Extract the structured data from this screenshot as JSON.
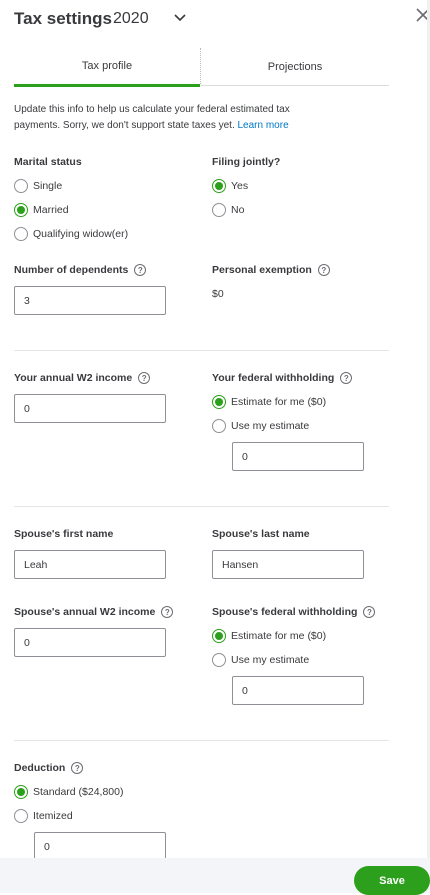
{
  "header": {
    "title": "Tax settings",
    "year": "2020"
  },
  "tabs": [
    {
      "label": "Tax profile"
    },
    {
      "label": "Projections"
    }
  ],
  "intro": {
    "text": "Update this info to help us calculate your federal estimated tax payments. Sorry, we don't support state taxes yet. ",
    "link": "Learn more"
  },
  "marital": {
    "label": "Marital status",
    "options": [
      "Single",
      "Married",
      "Qualifying widow(er)"
    ],
    "selected": "Married"
  },
  "filing": {
    "label": "Filing jointly?",
    "options": [
      "Yes",
      "No"
    ],
    "selected": "Yes"
  },
  "dependents": {
    "label": "Number of dependents",
    "value": "3"
  },
  "exemption": {
    "label": "Personal exemption",
    "value": "$0"
  },
  "w2": {
    "label": "Your annual W2 income",
    "value": "0"
  },
  "withholding": {
    "label": "Your federal withholding",
    "options": [
      "Estimate for me ($0)",
      "Use my estimate"
    ],
    "selected": "Estimate for me ($0)",
    "value": "0"
  },
  "spouse_first": {
    "label": "Spouse's first name",
    "value": "Leah"
  },
  "spouse_last": {
    "label": "Spouse's last name",
    "value": "Hansen"
  },
  "spouse_w2": {
    "label": "Spouse's annual W2 income",
    "value": "0"
  },
  "spouse_withholding": {
    "label": "Spouse's federal withholding",
    "options": [
      "Estimate for me ($0)",
      "Use my estimate"
    ],
    "selected": "Estimate for me ($0)",
    "value": "0"
  },
  "deduction": {
    "label": "Deduction",
    "options": [
      "Standard ($24,800)",
      "Itemized"
    ],
    "selected": "Standard ($24,800)",
    "value": "0"
  },
  "footer": {
    "save_label": "Save"
  },
  "help_glyph": "?",
  "colors": {
    "accent": "#2ca01c",
    "link": "#0077c5"
  }
}
